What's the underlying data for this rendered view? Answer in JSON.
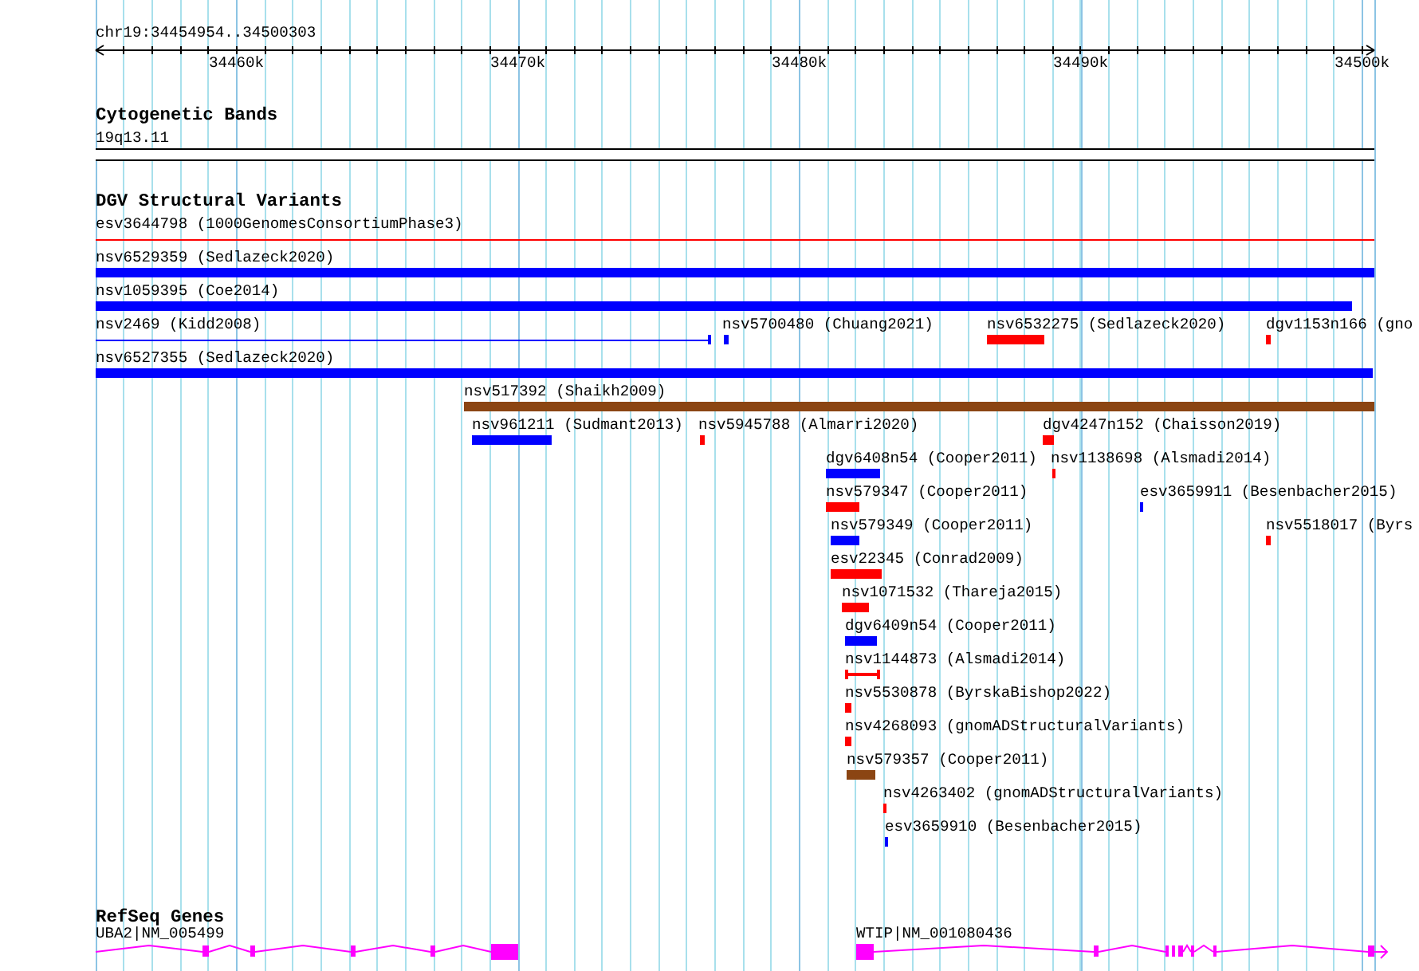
{
  "ruler": {
    "location": "chr19:34454954..34500303",
    "ticks": [
      "34460k",
      "34470k",
      "34480k",
      "34490k",
      "34500k"
    ]
  },
  "cytogenetic_bands": {
    "title": "Cytogenetic Bands",
    "band": "19q13.11"
  },
  "dgv_structural_variants": {
    "title": "DGV Structural Variants",
    "features": [
      {
        "label": "esv3644798 (1000GenomesConsortiumPhase3)",
        "color": "#ff0000",
        "kind": "line"
      },
      {
        "label": "nsv6529359 (Sedlazeck2020)",
        "color": "#0000ff",
        "kind": "bar"
      },
      {
        "label": "nsv1059395 (Coe2014)",
        "color": "#0000ff",
        "kind": "bar"
      },
      {
        "label": "nsv2469 (Kidd2008)",
        "color": "#0000ff",
        "kind": "line"
      },
      {
        "label": "nsv5700480 (Chuang2021)",
        "color": "#0000ff",
        "kind": "bar"
      },
      {
        "label": "nsv6532275 (Sedlazeck2020)",
        "color": "#ff0000",
        "kind": "bar"
      },
      {
        "label": "dgv1153n166 (gno",
        "color": "#ff0000",
        "kind": "bar"
      },
      {
        "label": "nsv6527355 (Sedlazeck2020)",
        "color": "#0000ff",
        "kind": "bar"
      },
      {
        "label": "nsv517392 (Shaikh2009)",
        "color": "#8b4513",
        "kind": "bar"
      },
      {
        "label": "nsv961211 (Sudmant2013)",
        "color": "#0000ff",
        "kind": "bar"
      },
      {
        "label": "nsv5945788 (Almarri2020)",
        "color": "#ff0000",
        "kind": "bar"
      },
      {
        "label": "dgv4247n152 (Chaisson2019)",
        "color": "#ff0000",
        "kind": "bar"
      },
      {
        "label": "dgv6408n54 (Cooper2011)",
        "color": "#0000ff",
        "kind": "bar"
      },
      {
        "label": "nsv1138698 (Alsmadi2014)",
        "color": "#ff0000",
        "kind": "bar"
      },
      {
        "label": "nsv579347 (Cooper2011)",
        "color": "#ff0000",
        "kind": "bar"
      },
      {
        "label": "esv3659911 (Besenbacher2015)",
        "color": "#0000ff",
        "kind": "bar"
      },
      {
        "label": "nsv579349 (Cooper2011)",
        "color": "#0000ff",
        "kind": "bar"
      },
      {
        "label": "nsv5518017 (Byrs",
        "color": "#ff0000",
        "kind": "bar"
      },
      {
        "label": "esv22345 (Conrad2009)",
        "color": "#ff0000",
        "kind": "bar"
      },
      {
        "label": "nsv1071532 (Thareja2015)",
        "color": "#ff0000",
        "kind": "bar"
      },
      {
        "label": "dgv6409n54 (Cooper2011)",
        "color": "#0000ff",
        "kind": "bar"
      },
      {
        "label": "nsv1144873 (Alsmadi2014)",
        "color": "#ff0000",
        "kind": "whisker"
      },
      {
        "label": "nsv5530878 (ByrskaBishop2022)",
        "color": "#ff0000",
        "kind": "bar"
      },
      {
        "label": "nsv4268093 (gnomADStructuralVariants)",
        "color": "#ff0000",
        "kind": "bar"
      },
      {
        "label": "nsv579357 (Cooper2011)",
        "color": "#8b4513",
        "kind": "bar"
      },
      {
        "label": "nsv4263402 (gnomADStructuralVariants)",
        "color": "#ff0000",
        "kind": "bar"
      },
      {
        "label": "esv3659910 (Besenbacher2015)",
        "color": "#0000ff",
        "kind": "bar"
      }
    ]
  },
  "refseq_genes": {
    "title": "RefSeq Genes",
    "genes": [
      {
        "label": "UBA2|NM_005499"
      },
      {
        "label": "WTIP|NM_001080436"
      }
    ]
  }
}
